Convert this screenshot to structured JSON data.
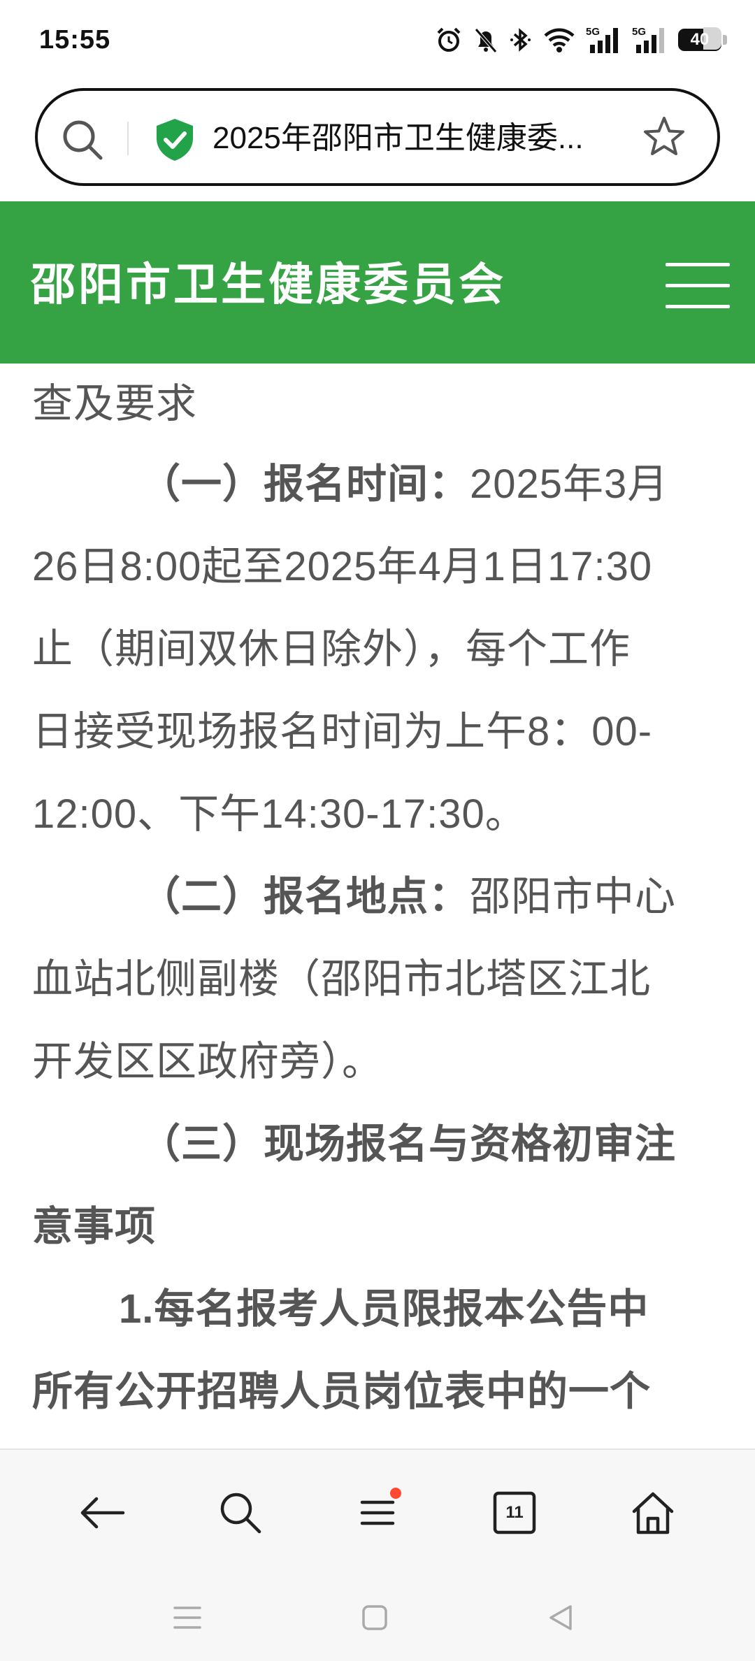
{
  "status_bar": {
    "time": "15:55",
    "signal_label": "5G",
    "battery_level": "40",
    "icons": [
      "alarm-icon",
      "mute-bell-icon",
      "bluetooth-icon",
      "wifi-icon",
      "signal-5g-icon",
      "signal-5g-icon",
      "battery-icon"
    ]
  },
  "address_bar": {
    "page_title": "2025年邵阳市卫生健康委...",
    "search_icon": "search-icon",
    "secure_icon": "shield-check-icon",
    "bookmark_icon": "star-icon"
  },
  "site_header": {
    "title": "邵阳市卫生健康委员会",
    "menu_icon": "hamburger-menu-icon",
    "color": "#35a244"
  },
  "article": {
    "line1": "查及要求",
    "s1_heading": "（一）报名时间：",
    "s1_text1": "2025年3月",
    "s1_text2": "26日8:00起至2025年4月1日17:30",
    "s1_text3": "止（期间双休日除外），每个工作",
    "s1_text4": "日接受现场报名时间为上午8：00-",
    "s1_text5": "12:00、下午14:30-17:30。",
    "s2_heading": "（二）报名地点：",
    "s2_text1": "邵阳市中心",
    "s2_text2": "血站北侧副楼（邵阳市北塔区江北",
    "s2_text3": "开发区区政府旁）。",
    "s3_heading1": "（三）现场报名与资格初审注",
    "s3_heading2": "意事项",
    "item1_line1": "1.每名报考人员限报本公告中",
    "item1_line2": "所有公开招聘人员岗位表中的一个"
  },
  "toolbar": {
    "tab_count": "11",
    "buttons": [
      "back-arrow-icon",
      "search-icon",
      "menu-list-icon",
      "tabs-icon",
      "home-icon"
    ],
    "notification_color": "#ff4a2f"
  },
  "system_nav": {
    "buttons": [
      "recent-apps-icon",
      "home-square-icon",
      "back-triangle-icon"
    ]
  }
}
